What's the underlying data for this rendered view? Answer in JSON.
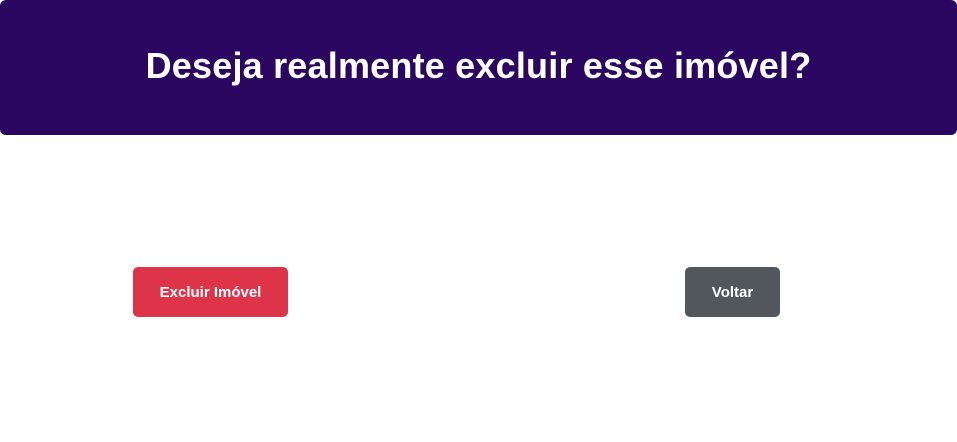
{
  "dialog": {
    "title": "Deseja realmente excluir esse imóvel?",
    "confirm_label": "Excluir Imóvel",
    "cancel_label": "Voltar"
  },
  "colors": {
    "header_background": "#2b0660",
    "danger": "#dd344a",
    "secondary": "#52575c"
  }
}
